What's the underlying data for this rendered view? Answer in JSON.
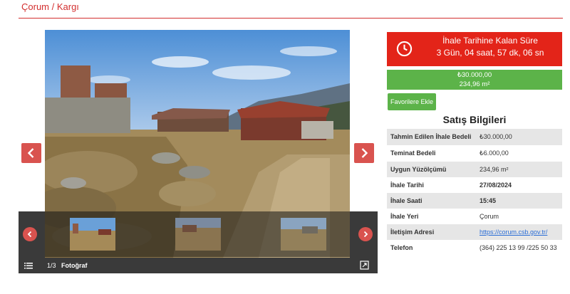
{
  "breadcrumb": "Çorum / Kargı",
  "gallery": {
    "counter": "1/3",
    "label": "Fotoğraf",
    "icons": {
      "prev": "chevron-left-icon",
      "next": "chevron-right-icon",
      "menu": "hamburger-menu-icon",
      "fullscreen": "expand-icon"
    }
  },
  "timer": {
    "title": "İhale Tarihine Kalan Süre",
    "remaining": "3 Gün, 04 saat, 57 dk, 06 sn",
    "icon": "clock-icon",
    "color": "#e32419"
  },
  "price": {
    "amount": "₺30.000,00",
    "area": "234,96 m²",
    "color": "#5cb349"
  },
  "favorite_button": "Favorilere Ekle",
  "sales_info": {
    "title": "Satış Bilgileri",
    "rows": [
      {
        "key": "Tahmin Edilen İhale Bedeli",
        "value": "₺30.000,00"
      },
      {
        "key": "Teminat Bedeli",
        "value": "₺6.000,00"
      },
      {
        "key": "Uygun Yüzölçümü",
        "value": "234,96 m²"
      },
      {
        "key": "İhale Tarihi",
        "value": "27/08/2024"
      },
      {
        "key": "İhale Saati",
        "value": "15:45"
      },
      {
        "key": "İhale Yeri",
        "value": "Çorum"
      },
      {
        "key": "İletişim Adresi",
        "value": "https://corum.csb.gov.tr/"
      },
      {
        "key": "Telefon",
        "value": "(364) 225 13 99 /225 50 33"
      }
    ]
  },
  "accent_color": "#d32f2f"
}
